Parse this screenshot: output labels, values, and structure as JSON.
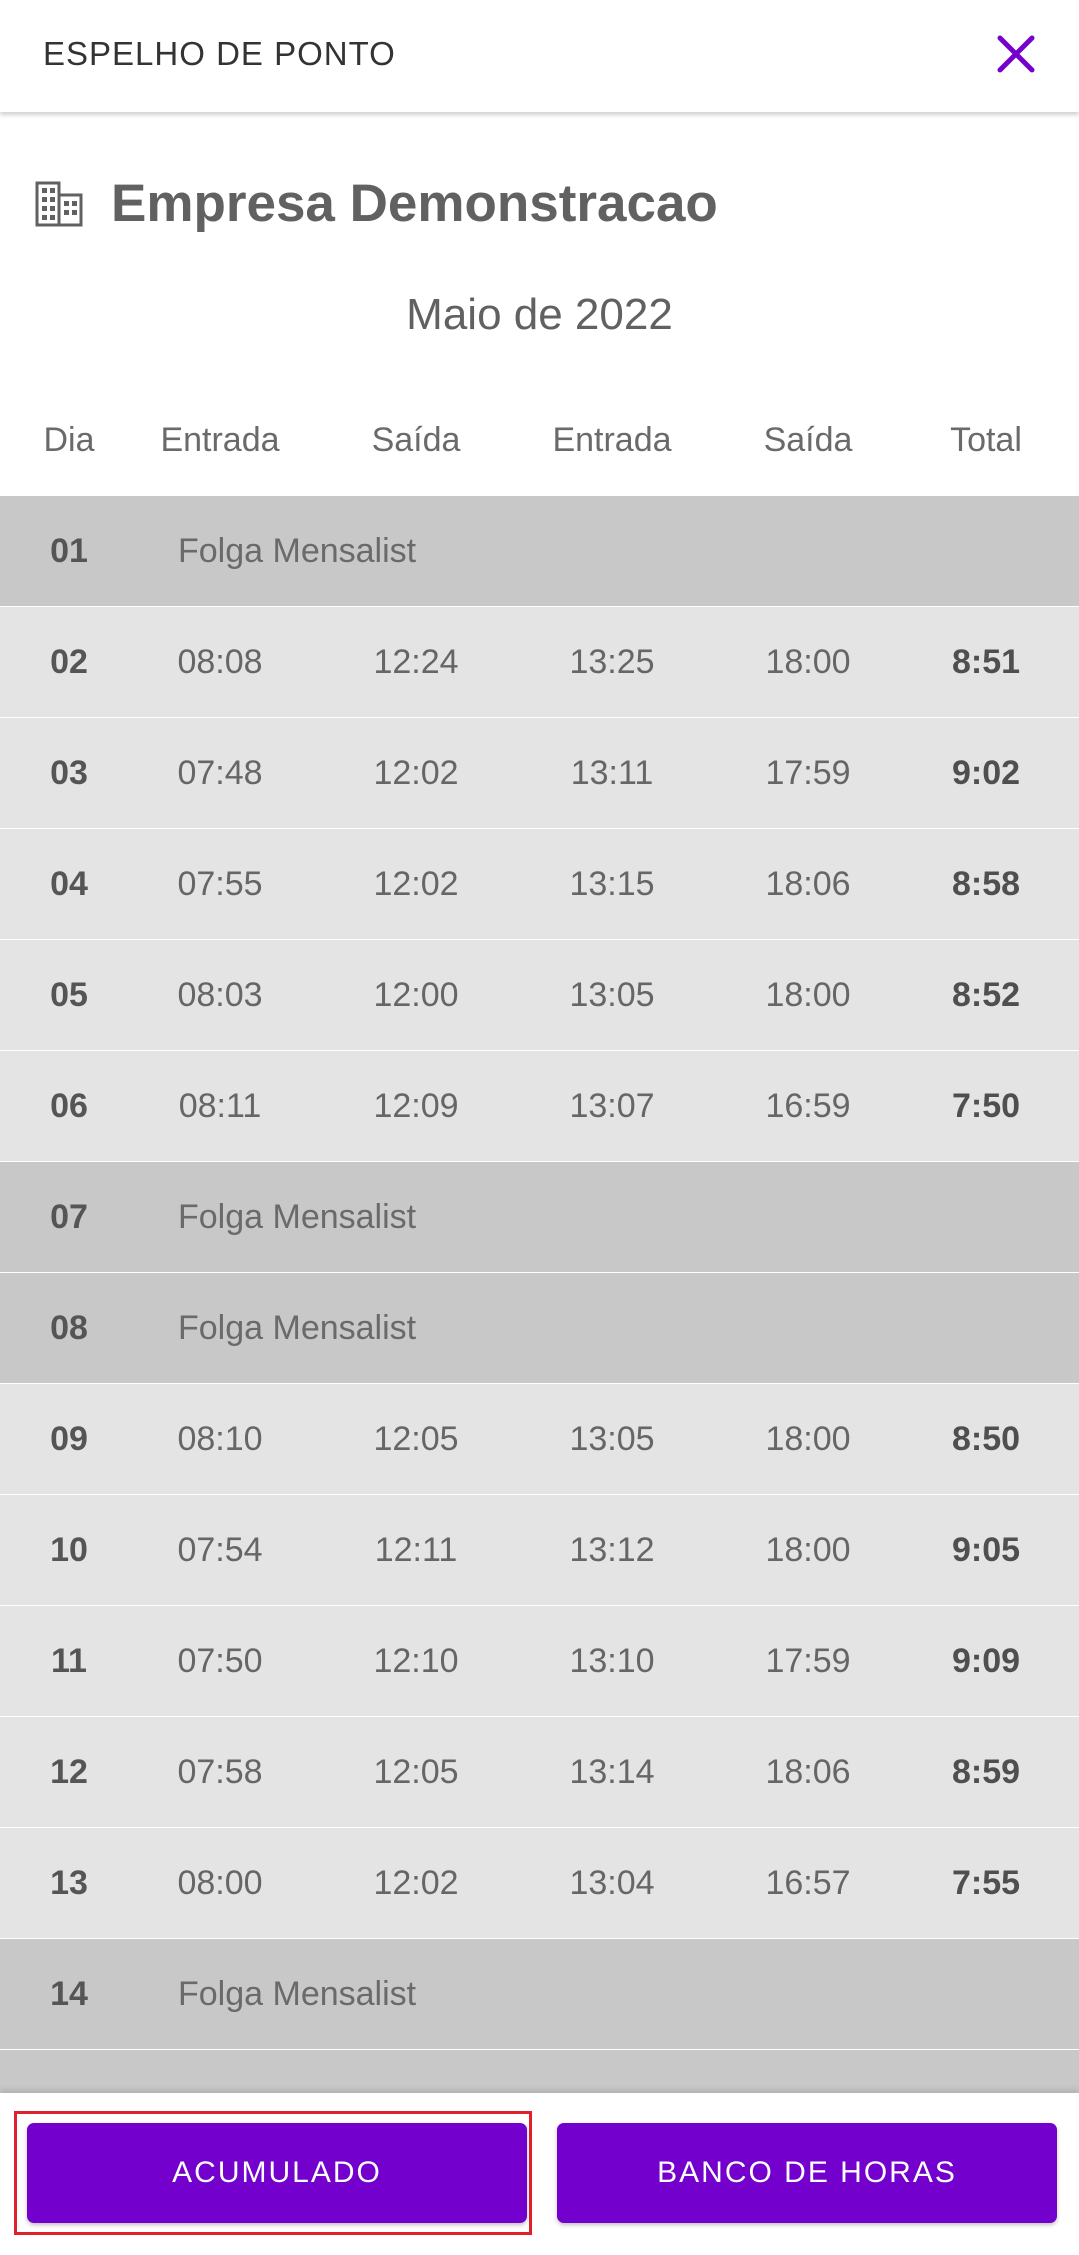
{
  "header": {
    "title": "ESPELHO DE PONTO"
  },
  "company": {
    "name": "Empresa Demonstracao"
  },
  "month": "Maio de 2022",
  "table": {
    "headers": [
      "Dia",
      "Entrada",
      "Saída",
      "Entrada",
      "Saída",
      "Total"
    ],
    "rows": [
      {
        "day": "01",
        "note": "Folga Mensalist"
      },
      {
        "day": "02",
        "times": [
          "08:08",
          "12:24",
          "13:25",
          "18:00"
        ],
        "total": "8:51"
      },
      {
        "day": "03",
        "times": [
          "07:48",
          "12:02",
          "13:11",
          "17:59"
        ],
        "total": "9:02"
      },
      {
        "day": "04",
        "times": [
          "07:55",
          "12:02",
          "13:15",
          "18:06"
        ],
        "total": "8:58"
      },
      {
        "day": "05",
        "times": [
          "08:03",
          "12:00",
          "13:05",
          "18:00"
        ],
        "total": "8:52"
      },
      {
        "day": "06",
        "times": [
          "08:11",
          "12:09",
          "13:07",
          "16:59"
        ],
        "total": "7:50"
      },
      {
        "day": "07",
        "note": "Folga Mensalist"
      },
      {
        "day": "08",
        "note": "Folga Mensalist"
      },
      {
        "day": "09",
        "times": [
          "08:10",
          "12:05",
          "13:05",
          "18:00"
        ],
        "total": "8:50"
      },
      {
        "day": "10",
        "times": [
          "07:54",
          "12:11",
          "13:12",
          "18:00"
        ],
        "total": "9:05"
      },
      {
        "day": "11",
        "times": [
          "07:50",
          "12:10",
          "13:10",
          "17:59"
        ],
        "total": "9:09"
      },
      {
        "day": "12",
        "times": [
          "07:58",
          "12:05",
          "13:14",
          "18:06"
        ],
        "total": "8:59"
      },
      {
        "day": "13",
        "times": [
          "08:00",
          "12:02",
          "13:04",
          "16:57"
        ],
        "total": "7:55"
      },
      {
        "day": "14",
        "note": "Folga Mensalist"
      },
      {
        "day": "",
        "note": ""
      }
    ]
  },
  "footer": {
    "accumulated_label": "ACUMULADO",
    "hour_bank_label": "BANCO DE HORAS"
  },
  "colors": {
    "accent": "#7300cc",
    "workday_row": "#e4e4e4",
    "dayoff_row": "#c8c8c8",
    "focus_outline": "#e0202a"
  },
  "icons": {
    "close": "close-icon",
    "company": "building-icon"
  }
}
